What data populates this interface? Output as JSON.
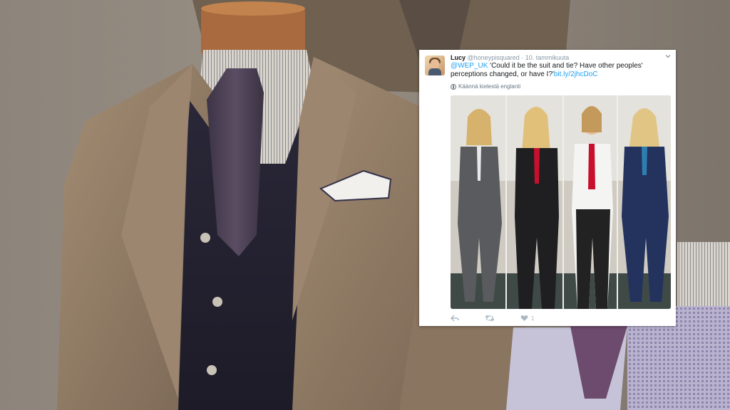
{
  "tweet": {
    "display_name": "Lucy",
    "handle": "@honeypisquared",
    "separator": "·",
    "date": "10. tammikuuta",
    "mention": "@WEP_UK",
    "text": " 'Could it be the suit and tie? Have other peoples' perceptions changed, or have I?'",
    "link": "bit.ly/2jhcDoC",
    "translate_label": "Käännä kielestä englanti",
    "like_count": "1"
  },
  "icons": {
    "menu": "chevron-down-icon",
    "reply": "reply-icon",
    "retweet": "retweet-icon",
    "like": "heart-icon",
    "translate": "globe-icon"
  },
  "colors": {
    "link": "#1da1f2",
    "muted": "#8899a6",
    "text": "#14171a",
    "action": "#aab8c2"
  }
}
